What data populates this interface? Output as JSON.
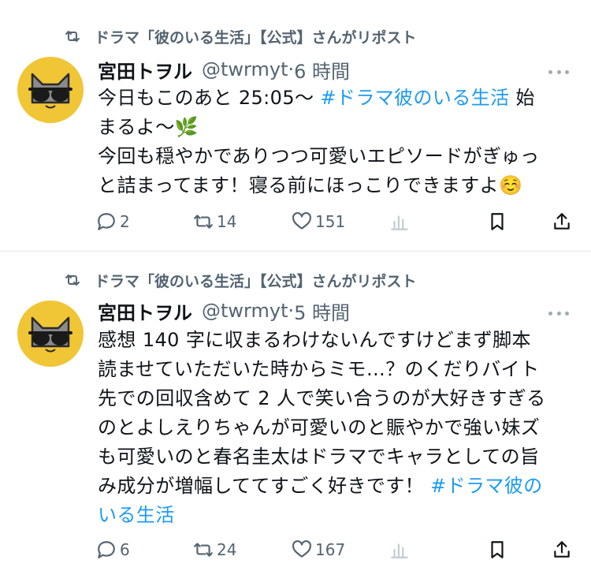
{
  "tweets": [
    {
      "repost_label": "ドラマ「彼のいる生活」【公式】さんがリポスト",
      "name": "宮田トヲル",
      "handle": "@twrmyt",
      "separator": "·",
      "time": "6 時間",
      "lines": [
        {
          "text": "今日もこのあと 25:05～ ",
          "hashtag": "#ドラマ彼のいる生活",
          "after": " 始"
        },
        {
          "text": "まるよ～🌿",
          "hashtag": "",
          "after": ""
        },
        {
          "text": "今回も穏やかでありつつ可愛いエピソードがぎゅっ",
          "hashtag": "",
          "after": ""
        },
        {
          "text": "と詰まってます！寝る前にほっこりできますよ☺️",
          "hashtag": "",
          "after": ""
        }
      ],
      "replies": "2",
      "reposts": "14",
      "likes": "151"
    },
    {
      "repost_label": "ドラマ「彼のいる生活」【公式】さんがリポスト",
      "name": "宮田トヲル",
      "handle": "@twrmyt",
      "separator": "·",
      "time": "5 時間",
      "lines": [
        {
          "text": "感想 140 字に収まるわけないんですけどまず脚本",
          "hashtag": "",
          "after": ""
        },
        {
          "text": "読ませていただいた時からミモ…？のくだりバイト",
          "hashtag": "",
          "after": ""
        },
        {
          "text": "先での回収含めて 2 人で笑い合うのが大好きすぎる",
          "hashtag": "",
          "after": ""
        },
        {
          "text": "のとよしえりちゃんが可愛いのと賑やかで強い妹ズ",
          "hashtag": "",
          "after": ""
        },
        {
          "text": "も可愛いのと春名圭太はドラマでキャラとしての旨",
          "hashtag": "",
          "after": ""
        },
        {
          "text": "み成分が増幅しててすごく好きです！ ",
          "hashtag": "#ドラマ彼の",
          "after": ""
        },
        {
          "text": "",
          "hashtag": "いる生活",
          "after": ""
        }
      ],
      "replies": "6",
      "reposts": "24",
      "likes": "167"
    }
  ],
  "icons": {
    "repost": "repost-icon",
    "reply": "reply-icon",
    "like": "heart-icon",
    "views": "views-icon",
    "bookmark": "bookmark-icon",
    "share": "share-icon",
    "more": "more-icon"
  },
  "colors": {
    "hashtag": "#1d9bf0",
    "muted": "#536471",
    "avatar_bg": "#f0c636"
  }
}
